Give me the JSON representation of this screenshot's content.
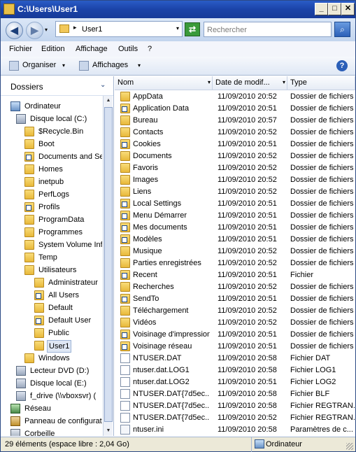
{
  "window": {
    "title": "C:\\Users\\User1",
    "minimize": "_",
    "maximize": "□",
    "close": "✕"
  },
  "address": {
    "path": "User1",
    "sep": "▸",
    "dropdown": "▾"
  },
  "nav": {
    "back": "◀",
    "forward": "▶",
    "history": "▾",
    "refresh": "⇄"
  },
  "search": {
    "placeholder": "Rechercher",
    "icon": "⌕"
  },
  "menu": {
    "file": "Fichier",
    "edit": "Edition",
    "view": "Affichage",
    "tools": "Outils",
    "help": "?"
  },
  "toolbar": {
    "organize": "Organiser",
    "organize_dd": "▾",
    "views": "Affichages",
    "views_dd": "▾",
    "help": "?"
  },
  "tree": {
    "header": "Dossiers",
    "chevron": "⌄",
    "items": [
      {
        "label": "Ordinateur",
        "icon": "pc"
      },
      {
        "label": "Disque local (C:)",
        "icon": "drive"
      },
      {
        "label": "$Recycle.Bin",
        "icon": "folder"
      },
      {
        "label": "Boot",
        "icon": "folder"
      },
      {
        "label": "Documents and Se",
        "icon": "folder-shortcut"
      },
      {
        "label": "Homes",
        "icon": "folder"
      },
      {
        "label": "inetpub",
        "icon": "folder"
      },
      {
        "label": "PerfLogs",
        "icon": "folder"
      },
      {
        "label": "Profils",
        "icon": "folder-shortcut"
      },
      {
        "label": "ProgramData",
        "icon": "folder"
      },
      {
        "label": "Programmes",
        "icon": "folder"
      },
      {
        "label": "System Volume Inf",
        "icon": "folder"
      },
      {
        "label": "Temp",
        "icon": "folder"
      },
      {
        "label": "Utilisateurs",
        "icon": "folder"
      },
      {
        "label": "Administrateur",
        "icon": "folder"
      },
      {
        "label": "All Users",
        "icon": "folder-shortcut"
      },
      {
        "label": "Default",
        "icon": "folder"
      },
      {
        "label": "Default User",
        "icon": "folder-shortcut"
      },
      {
        "label": "Public",
        "icon": "folder"
      },
      {
        "label": "User1",
        "icon": "folder"
      },
      {
        "label": "Windows",
        "icon": "folder"
      },
      {
        "label": "Lecteur DVD (D:)",
        "icon": "drive"
      },
      {
        "label": "Disque local (E:)",
        "icon": "drive"
      },
      {
        "label": "f_drive (\\\\vboxsvr) (",
        "icon": "drive"
      },
      {
        "label": "Réseau",
        "icon": "net"
      },
      {
        "label": "Panneau de configurat",
        "icon": "ctl"
      },
      {
        "label": "Corbeille",
        "icon": "bin"
      }
    ]
  },
  "columns": {
    "name": "Nom",
    "date": "Date de modif...",
    "type": "Type",
    "dd": "▾"
  },
  "files": [
    {
      "name": "AppData",
      "date": "11/09/2010 20:52",
      "type": "Dossier de fichiers",
      "icon": "folder"
    },
    {
      "name": "Application Data",
      "date": "11/09/2010 20:51",
      "type": "Dossier de fichiers",
      "icon": "folder-shortcut"
    },
    {
      "name": "Bureau",
      "date": "11/09/2010 20:57",
      "type": "Dossier de fichiers",
      "icon": "folder"
    },
    {
      "name": "Contacts",
      "date": "11/09/2010 20:52",
      "type": "Dossier de fichiers",
      "icon": "folder"
    },
    {
      "name": "Cookies",
      "date": "11/09/2010 20:51",
      "type": "Dossier de fichiers",
      "icon": "folder-shortcut"
    },
    {
      "name": "Documents",
      "date": "11/09/2010 20:52",
      "type": "Dossier de fichiers",
      "icon": "folder"
    },
    {
      "name": "Favoris",
      "date": "11/09/2010 20:52",
      "type": "Dossier de fichiers",
      "icon": "folder"
    },
    {
      "name": "Images",
      "date": "11/09/2010 20:52",
      "type": "Dossier de fichiers",
      "icon": "folder"
    },
    {
      "name": "Liens",
      "date": "11/09/2010 20:52",
      "type": "Dossier de fichiers",
      "icon": "folder"
    },
    {
      "name": "Local Settings",
      "date": "11/09/2010 20:51",
      "type": "Dossier de fichiers",
      "icon": "folder-shortcut"
    },
    {
      "name": "Menu Démarrer",
      "date": "11/09/2010 20:51",
      "type": "Dossier de fichiers",
      "icon": "folder-shortcut"
    },
    {
      "name": "Mes documents",
      "date": "11/09/2010 20:51",
      "type": "Dossier de fichiers",
      "icon": "folder-shortcut"
    },
    {
      "name": "Modèles",
      "date": "11/09/2010 20:51",
      "type": "Dossier de fichiers",
      "icon": "folder-shortcut"
    },
    {
      "name": "Musique",
      "date": "11/09/2010 20:52",
      "type": "Dossier de fichiers",
      "icon": "folder"
    },
    {
      "name": "Parties enregistrées",
      "date": "11/09/2010 20:52",
      "type": "Dossier de fichiers",
      "icon": "folder"
    },
    {
      "name": "Recent",
      "date": "11/09/2010 20:51",
      "type": "Fichier",
      "icon": "folder-shortcut"
    },
    {
      "name": "Recherches",
      "date": "11/09/2010 20:52",
      "type": "Dossier de fichiers",
      "icon": "folder"
    },
    {
      "name": "SendTo",
      "date": "11/09/2010 20:51",
      "type": "Dossier de fichiers",
      "icon": "folder-shortcut"
    },
    {
      "name": "Téléchargement",
      "date": "11/09/2010 20:52",
      "type": "Dossier de fichiers",
      "icon": "folder"
    },
    {
      "name": "Vidéos",
      "date": "11/09/2010 20:52",
      "type": "Dossier de fichiers",
      "icon": "folder"
    },
    {
      "name": "Voisinage d'impression",
      "date": "11/09/2010 20:51",
      "type": "Dossier de fichiers",
      "icon": "folder-shortcut"
    },
    {
      "name": "Voisinage réseau",
      "date": "11/09/2010 20:51",
      "type": "Dossier de fichiers",
      "icon": "folder-shortcut"
    },
    {
      "name": "NTUSER.DAT",
      "date": "11/09/2010 20:58",
      "type": "Fichier DAT",
      "icon": "doc"
    },
    {
      "name": "ntuser.dat.LOG1",
      "date": "11/09/2010 20:58",
      "type": "Fichier LOG1",
      "icon": "doc"
    },
    {
      "name": "ntuser.dat.LOG2",
      "date": "11/09/2010 20:51",
      "type": "Fichier LOG2",
      "icon": "doc"
    },
    {
      "name": "NTUSER.DAT{7d5ec...",
      "date": "11/09/2010 20:58",
      "type": "Fichier BLF",
      "icon": "doc"
    },
    {
      "name": "NTUSER.DAT{7d5ec...",
      "date": "11/09/2010 20:58",
      "type": "Fichier REGTRAN...",
      "icon": "doc"
    },
    {
      "name": "NTUSER.DAT{7d5ec...",
      "date": "11/09/2010 20:52",
      "type": "Fichier REGTRAN...",
      "icon": "doc"
    },
    {
      "name": "ntuser.ini",
      "date": "11/09/2010 20:58",
      "type": "Paramètres de c...",
      "icon": "ini"
    }
  ],
  "status": {
    "count": "29 éléments (espace libre : 2,04 Go)",
    "location": "Ordinateur"
  }
}
